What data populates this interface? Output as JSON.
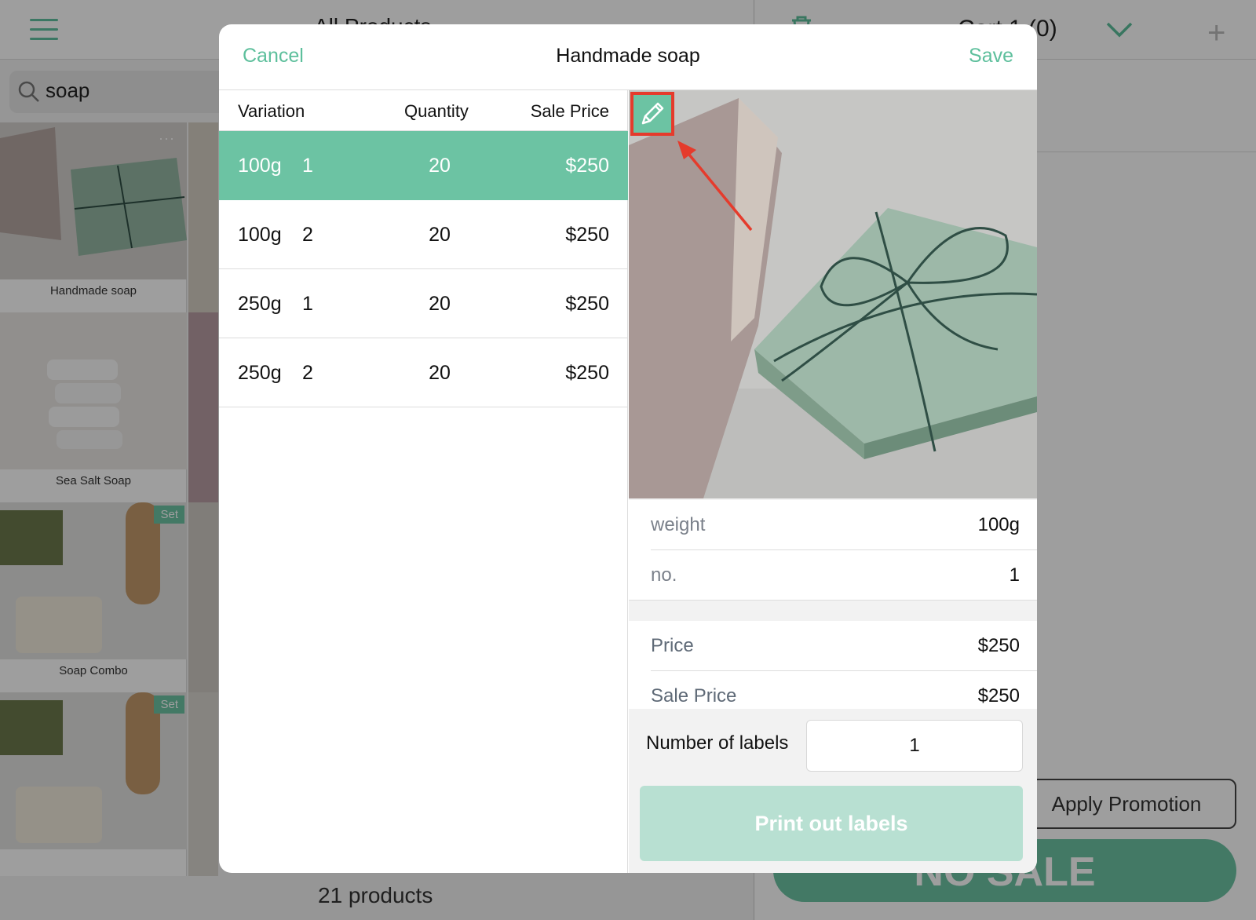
{
  "background": {
    "tab_text": "All Products",
    "cart_title": "Cart 1 (0)",
    "search": {
      "value": "soap"
    },
    "products": [
      {
        "name": "Handmade soap",
        "badge": ""
      },
      {
        "name": "Sea Salt Soap",
        "badge": ""
      },
      {
        "name": "Soap Combo",
        "badge": "Set"
      },
      {
        "name": "",
        "badge": "Set"
      }
    ],
    "product_count": "21 products",
    "apply_promotion_label": "Apply Promotion",
    "no_sale_label": "NO SALE"
  },
  "modal": {
    "title": "Handmade soap",
    "cancel_label": "Cancel",
    "save_label": "Save",
    "columns": {
      "variation": "Variation",
      "quantity": "Quantity",
      "sale_price": "Sale Price"
    },
    "rows": [
      {
        "size": "100g",
        "no": "1",
        "quantity": "20",
        "price": "$250",
        "selected": true
      },
      {
        "size": "100g",
        "no": "2",
        "quantity": "20",
        "price": "$250",
        "selected": false
      },
      {
        "size": "250g",
        "no": "1",
        "quantity": "20",
        "price": "$250",
        "selected": false
      },
      {
        "size": "250g",
        "no": "2",
        "quantity": "20",
        "price": "$250",
        "selected": false
      }
    ],
    "attributes": [
      {
        "key": "weight",
        "value": "100g"
      },
      {
        "key": "no.",
        "value": "1"
      }
    ],
    "prices": [
      {
        "key": "Price",
        "value": "$250"
      },
      {
        "key": "Sale Price",
        "value": "$250"
      }
    ],
    "labels_label": "Number of labels",
    "labels_value": "1",
    "print_label": "Print out labels"
  },
  "colors": {
    "accent": "#6cc3a3",
    "accent_light": "#b8e0d2",
    "highlight": "#e53b2c"
  }
}
